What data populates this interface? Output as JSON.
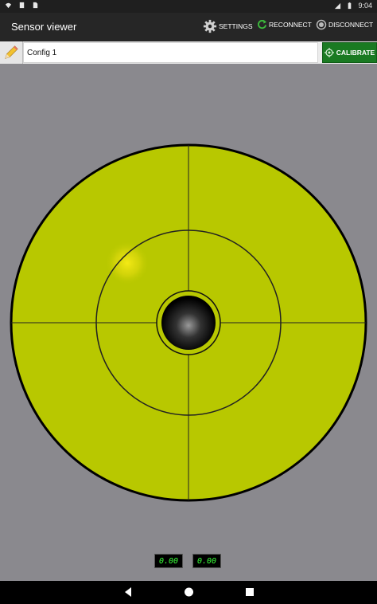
{
  "status_bar": {
    "time": "9:04",
    "icons": [
      "wifi-icon",
      "clipboard-icon",
      "sim-icon",
      "cell-signal-icon",
      "battery-icon"
    ]
  },
  "app_bar": {
    "title": "Sensor viewer",
    "actions": {
      "settings": "SETTINGS",
      "reconnect": "RECONNECT",
      "disconnect": "DISCONNECT"
    }
  },
  "toolbar": {
    "config_value": "Config 1",
    "calibrate_label": "CALIBRATE"
  },
  "gauge": {
    "face_color": "#b8c800",
    "target_color": "#000000"
  },
  "readouts": {
    "x": "0.00",
    "y": "0.00"
  },
  "nav_bar": {
    "icons": [
      "back-icon",
      "home-icon",
      "recents-icon"
    ]
  }
}
